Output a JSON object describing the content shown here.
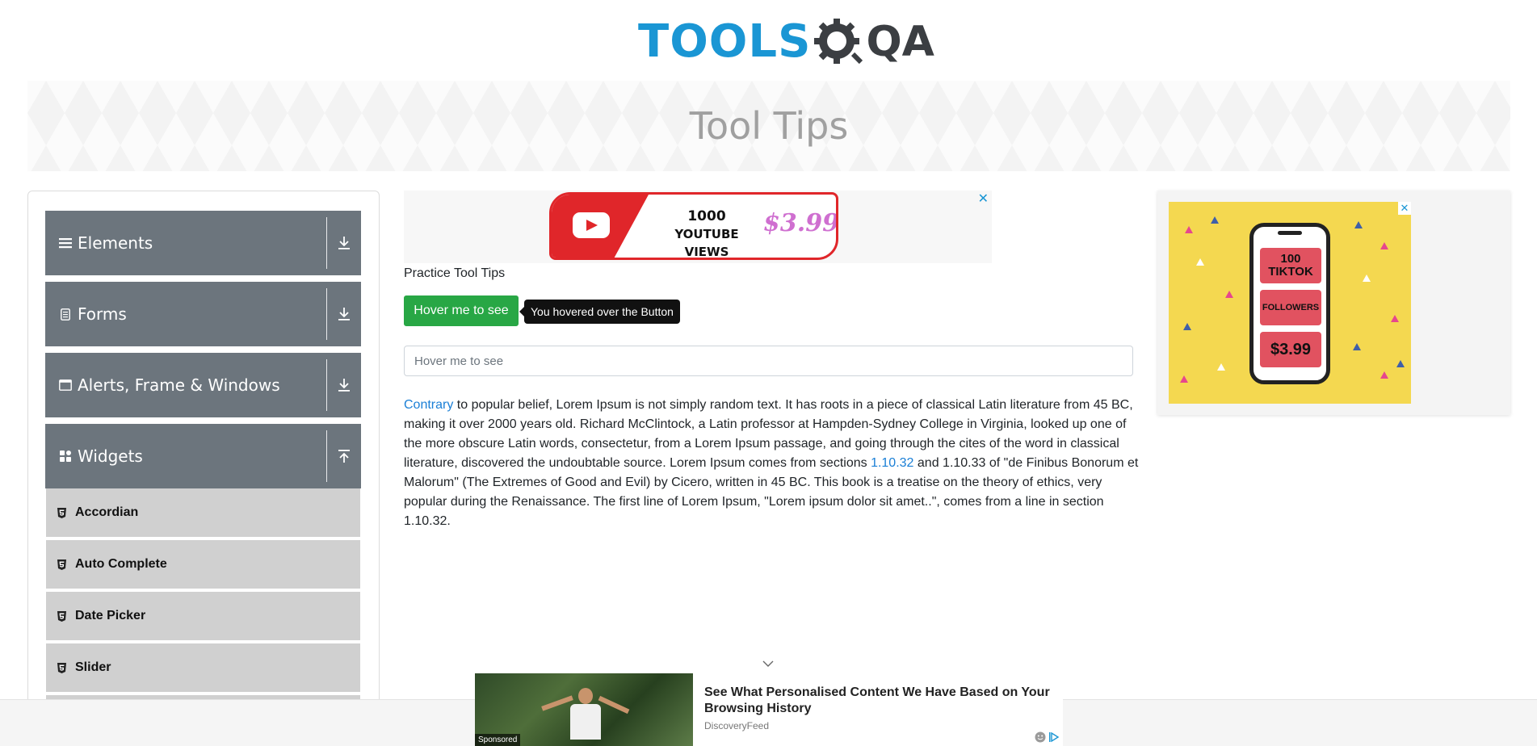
{
  "header": {
    "logo_text": "TOOLS",
    "logo_qa": "QA"
  },
  "banner": {
    "title": "Tool Tips"
  },
  "sidebar": {
    "groups": [
      {
        "label": "Elements",
        "icon": "menu-icon",
        "arrow": "download-icon"
      },
      {
        "label": "Forms",
        "icon": "form-icon",
        "arrow": "download-icon"
      },
      {
        "label": "Alerts, Frame & Windows",
        "icon": "window-icon",
        "arrow": "download-icon"
      },
      {
        "label": "Widgets",
        "icon": "widgets-icon",
        "arrow": "upload-icon"
      }
    ],
    "widget_items": [
      {
        "label": "Accordian",
        "icon": "html5-icon"
      },
      {
        "label": "Auto Complete",
        "icon": "html5-icon"
      },
      {
        "label": "Date Picker",
        "icon": "html5-icon"
      },
      {
        "label": "Slider",
        "icon": "html5-icon"
      }
    ]
  },
  "top_ad": {
    "line1": "1000",
    "line2": "YOUTUBE VIEWS",
    "price": "$3.99",
    "close": "✕"
  },
  "main": {
    "practice_title": "Practice Tool Tips",
    "hover_button_label": "Hover me to see",
    "tooltip_text": "You hovered over the Button",
    "hover_input_placeholder": "Hover me to see",
    "paragraph": {
      "link1": "Contrary",
      "text1": " to popular belief, Lorem Ipsum is not simply random text. It has roots in a piece of classical Latin literature from 45 BC, making it over 2000 years old. Richard McClintock, a Latin professor at Hampden-Sydney College in Virginia, looked up one of the more obscure Latin words, consectetur, from a Lorem Ipsum passage, and going through the cites of the word in classical literature, discovered the undoubtable source. Lorem Ipsum comes from sections ",
      "link2": "1.10.32",
      "text2": " and 1.10.33 of \"de Finibus Bonorum et Malorum\" (The Extremes of Good and Evil) by Cicero, written in 45 BC. This book is a treatise on the theory of ethics, very popular during the Renaissance. The first line of Lorem Ipsum, \"Lorem ipsum dolor sit amet..\", comes from a line in section 1.10.32."
    }
  },
  "right_ad": {
    "line1": "100",
    "line2": "TIKTOK",
    "followers": "FOLLOWERS",
    "price": "$3.99",
    "close": "✕"
  },
  "bottom_ad": {
    "title": "See What Personalised Content We Have Based on Your Browsing History",
    "source": "DiscoveryFeed",
    "sponsored": "Sponsored"
  },
  "colors": {
    "brand_blue": "#1a96d4",
    "sidebar_header": "#6c757d",
    "button_green": "#28a745",
    "link_blue": "#1a7fd6"
  }
}
